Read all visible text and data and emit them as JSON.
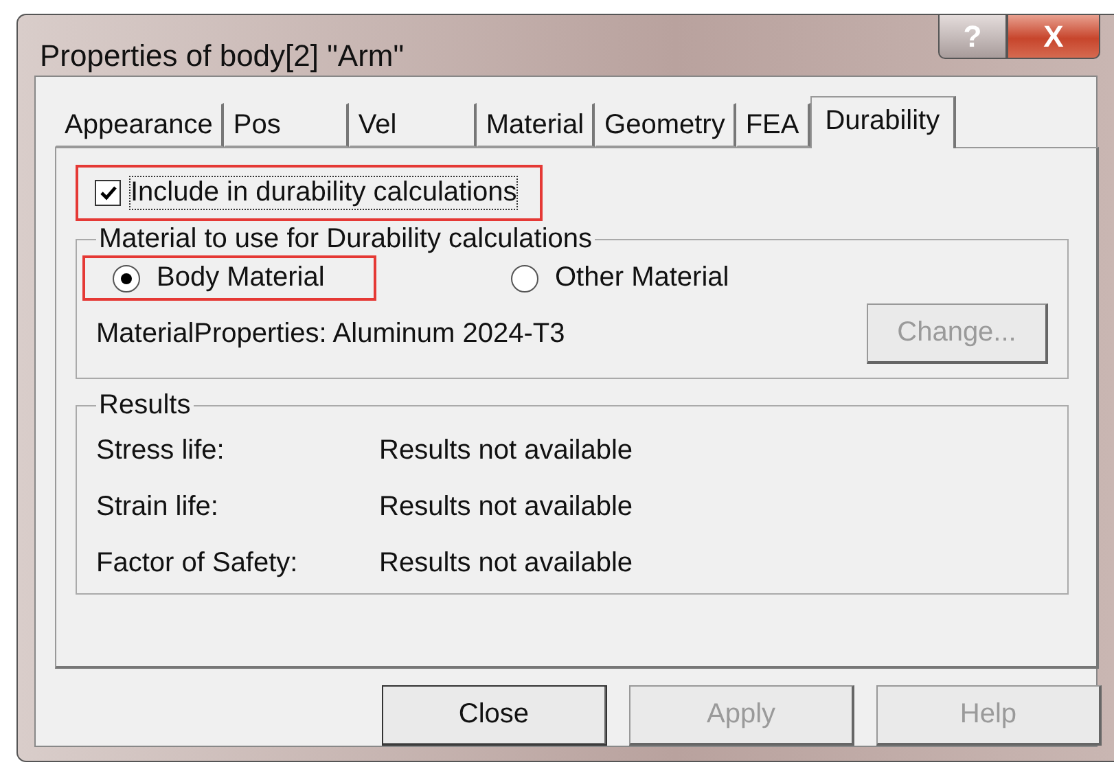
{
  "window": {
    "title": "Properties of body[2] \"Arm\"",
    "help_glyph": "?",
    "close_glyph": "X"
  },
  "tabs": [
    {
      "label": "Appearance",
      "selected": false
    },
    {
      "label": "Pos",
      "selected": false
    },
    {
      "label": "Vel",
      "selected": false
    },
    {
      "label": "Material",
      "selected": false
    },
    {
      "label": "Geometry",
      "selected": false
    },
    {
      "label": "FEA",
      "selected": false
    },
    {
      "label": "Durability",
      "selected": true
    }
  ],
  "include_checkbox": {
    "label": "Include in durability calculations",
    "checked": true,
    "highlighted": true
  },
  "material_group": {
    "title": "Material to use for Durability calculations",
    "options": [
      {
        "label": "Body Material",
        "selected": true,
        "highlighted": true
      },
      {
        "label": "Other Material",
        "selected": false,
        "highlighted": false
      }
    ],
    "properties_text": "MaterialProperties: Aluminum 2024-T3",
    "change_button": {
      "label": "Change...",
      "disabled": true
    }
  },
  "results_group": {
    "title": "Results",
    "rows": [
      {
        "label": "Stress life:",
        "value": "Results not available"
      },
      {
        "label": "Strain life:",
        "value": "Results not available"
      },
      {
        "label": "Factor of Safety:",
        "value": "Results not available"
      }
    ]
  },
  "buttons": [
    {
      "label": "Close",
      "disabled": false
    },
    {
      "label": "Apply",
      "disabled": true
    },
    {
      "label": "Help",
      "disabled": true
    }
  ]
}
